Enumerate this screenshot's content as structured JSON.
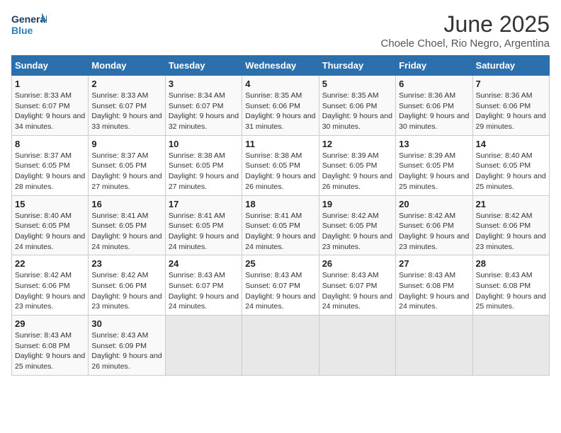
{
  "header": {
    "logo_line1": "General",
    "logo_line2": "Blue",
    "month_title": "June 2025",
    "subtitle": "Choele Choel, Rio Negro, Argentina"
  },
  "weekdays": [
    "Sunday",
    "Monday",
    "Tuesday",
    "Wednesday",
    "Thursday",
    "Friday",
    "Saturday"
  ],
  "weeks": [
    [
      {
        "num": "1",
        "sunrise": "8:33 AM",
        "sunset": "6:07 PM",
        "daylight": "9 hours and 34 minutes."
      },
      {
        "num": "2",
        "sunrise": "8:33 AM",
        "sunset": "6:07 PM",
        "daylight": "9 hours and 33 minutes."
      },
      {
        "num": "3",
        "sunrise": "8:34 AM",
        "sunset": "6:07 PM",
        "daylight": "9 hours and 32 minutes."
      },
      {
        "num": "4",
        "sunrise": "8:35 AM",
        "sunset": "6:06 PM",
        "daylight": "9 hours and 31 minutes."
      },
      {
        "num": "5",
        "sunrise": "8:35 AM",
        "sunset": "6:06 PM",
        "daylight": "9 hours and 30 minutes."
      },
      {
        "num": "6",
        "sunrise": "8:36 AM",
        "sunset": "6:06 PM",
        "daylight": "9 hours and 30 minutes."
      },
      {
        "num": "7",
        "sunrise": "8:36 AM",
        "sunset": "6:06 PM",
        "daylight": "9 hours and 29 minutes."
      }
    ],
    [
      {
        "num": "8",
        "sunrise": "8:37 AM",
        "sunset": "6:05 PM",
        "daylight": "9 hours and 28 minutes."
      },
      {
        "num": "9",
        "sunrise": "8:37 AM",
        "sunset": "6:05 PM",
        "daylight": "9 hours and 27 minutes."
      },
      {
        "num": "10",
        "sunrise": "8:38 AM",
        "sunset": "6:05 PM",
        "daylight": "9 hours and 27 minutes."
      },
      {
        "num": "11",
        "sunrise": "8:38 AM",
        "sunset": "6:05 PM",
        "daylight": "9 hours and 26 minutes."
      },
      {
        "num": "12",
        "sunrise": "8:39 AM",
        "sunset": "6:05 PM",
        "daylight": "9 hours and 26 minutes."
      },
      {
        "num": "13",
        "sunrise": "8:39 AM",
        "sunset": "6:05 PM",
        "daylight": "9 hours and 25 minutes."
      },
      {
        "num": "14",
        "sunrise": "8:40 AM",
        "sunset": "6:05 PM",
        "daylight": "9 hours and 25 minutes."
      }
    ],
    [
      {
        "num": "15",
        "sunrise": "8:40 AM",
        "sunset": "6:05 PM",
        "daylight": "9 hours and 24 minutes."
      },
      {
        "num": "16",
        "sunrise": "8:41 AM",
        "sunset": "6:05 PM",
        "daylight": "9 hours and 24 minutes."
      },
      {
        "num": "17",
        "sunrise": "8:41 AM",
        "sunset": "6:05 PM",
        "daylight": "9 hours and 24 minutes."
      },
      {
        "num": "18",
        "sunrise": "8:41 AM",
        "sunset": "6:05 PM",
        "daylight": "9 hours and 24 minutes."
      },
      {
        "num": "19",
        "sunrise": "8:42 AM",
        "sunset": "6:05 PM",
        "daylight": "9 hours and 23 minutes."
      },
      {
        "num": "20",
        "sunrise": "8:42 AM",
        "sunset": "6:06 PM",
        "daylight": "9 hours and 23 minutes."
      },
      {
        "num": "21",
        "sunrise": "8:42 AM",
        "sunset": "6:06 PM",
        "daylight": "9 hours and 23 minutes."
      }
    ],
    [
      {
        "num": "22",
        "sunrise": "8:42 AM",
        "sunset": "6:06 PM",
        "daylight": "9 hours and 23 minutes."
      },
      {
        "num": "23",
        "sunrise": "8:42 AM",
        "sunset": "6:06 PM",
        "daylight": "9 hours and 23 minutes."
      },
      {
        "num": "24",
        "sunrise": "8:43 AM",
        "sunset": "6:07 PM",
        "daylight": "9 hours and 24 minutes."
      },
      {
        "num": "25",
        "sunrise": "8:43 AM",
        "sunset": "6:07 PM",
        "daylight": "9 hours and 24 minutes."
      },
      {
        "num": "26",
        "sunrise": "8:43 AM",
        "sunset": "6:07 PM",
        "daylight": "9 hours and 24 minutes."
      },
      {
        "num": "27",
        "sunrise": "8:43 AM",
        "sunset": "6:08 PM",
        "daylight": "9 hours and 24 minutes."
      },
      {
        "num": "28",
        "sunrise": "8:43 AM",
        "sunset": "6:08 PM",
        "daylight": "9 hours and 25 minutes."
      }
    ],
    [
      {
        "num": "29",
        "sunrise": "8:43 AM",
        "sunset": "6:08 PM",
        "daylight": "9 hours and 25 minutes."
      },
      {
        "num": "30",
        "sunrise": "8:43 AM",
        "sunset": "6:09 PM",
        "daylight": "9 hours and 26 minutes."
      },
      null,
      null,
      null,
      null,
      null
    ]
  ]
}
